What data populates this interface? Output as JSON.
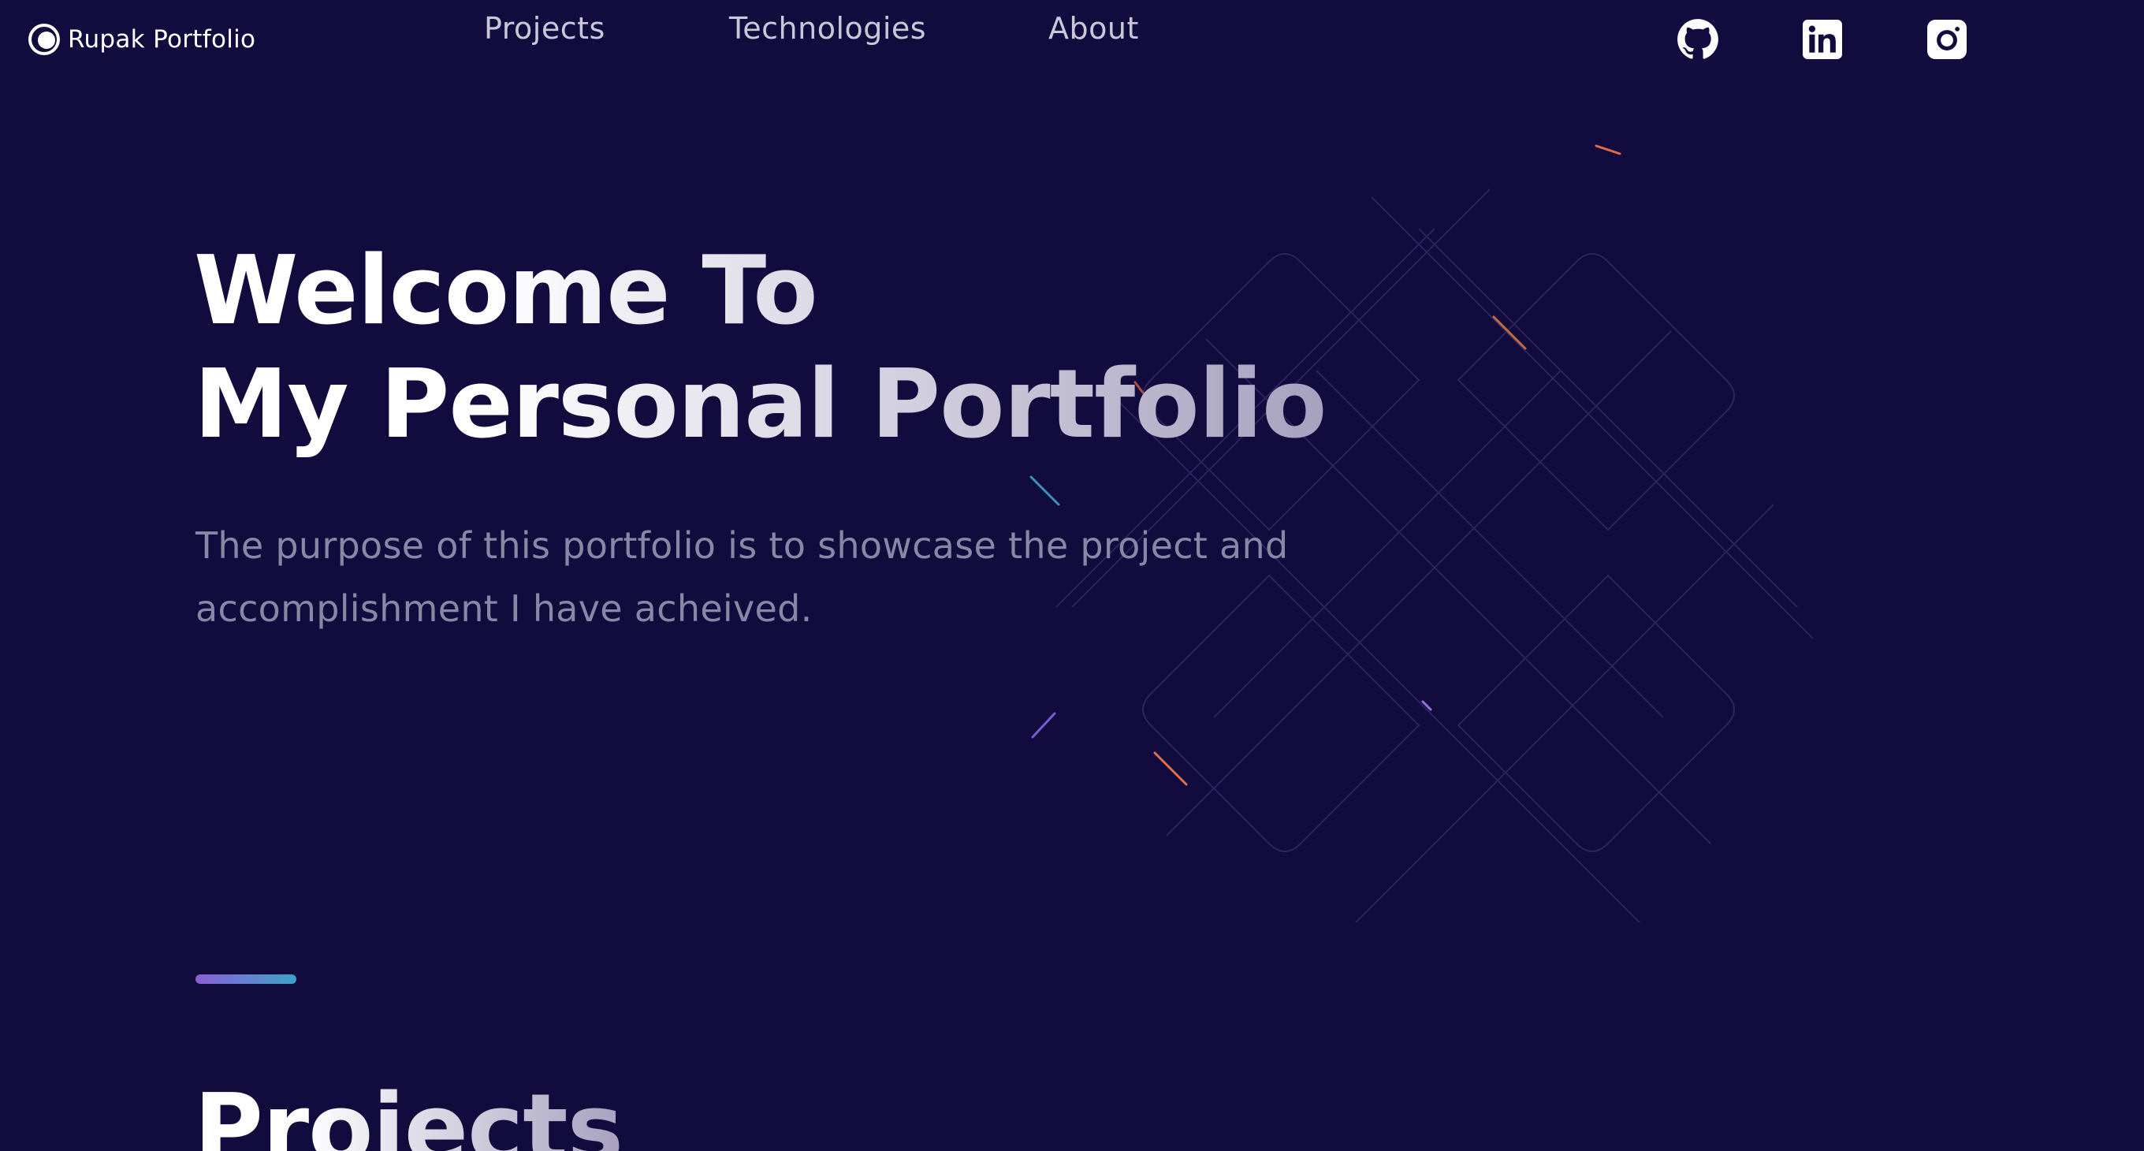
{
  "nav": {
    "brand": "Rupak Portfolio",
    "links": [
      {
        "label": "Projects"
      },
      {
        "label": "Technologies"
      },
      {
        "label": "About"
      }
    ],
    "social": [
      {
        "icon": "github-icon"
      },
      {
        "icon": "linkedin-icon"
      },
      {
        "icon": "instagram-icon"
      }
    ]
  },
  "hero": {
    "title_line1": "Welcome To",
    "title_line2": "My Personal Portfolio",
    "subtitle": "The purpose of this portfolio is to showcase the project and accomplishment I have acheived."
  },
  "section": {
    "title": "Projects"
  },
  "colors": {
    "background": "#120c3e",
    "text": "#ffffff",
    "muted_text": "#8a86a6",
    "accent_gradient_start": "#8b5fd6",
    "accent_gradient_end": "#3fa2c8"
  }
}
